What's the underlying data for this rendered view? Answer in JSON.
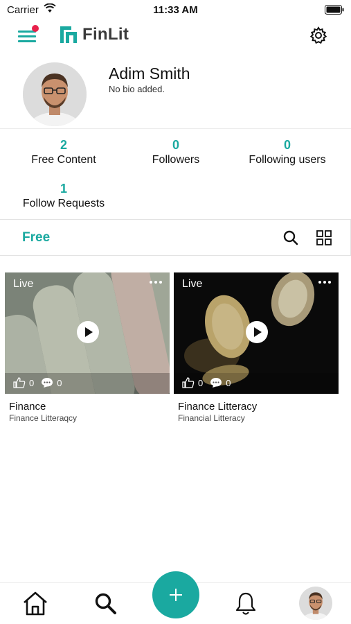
{
  "status_bar": {
    "carrier": "Carrier",
    "time": "11:33 AM"
  },
  "header": {
    "app_name": "FinLit",
    "menu_icon": "hamburger-icon",
    "settings_icon": "gear-icon"
  },
  "profile": {
    "name": "Adim Smith",
    "bio": "No bio added."
  },
  "stats": [
    {
      "value": "2",
      "label": "Free Content"
    },
    {
      "value": "0",
      "label": "Followers"
    },
    {
      "value": "0",
      "label": "Following users"
    },
    {
      "value": "1",
      "label": "Follow Requests"
    }
  ],
  "filter": {
    "active_tab": "Free",
    "search_icon": "search-icon",
    "grid_icon": "grid-icon"
  },
  "content": [
    {
      "badge": "Live",
      "likes": "0",
      "comments": "0",
      "title": "Finance",
      "subtitle": "Finance Litteraqcy"
    },
    {
      "badge": "Live",
      "likes": "0",
      "comments": "0",
      "title": "Finance Litteracy",
      "subtitle": "Financial Litteracy"
    }
  ],
  "tab_bar": {
    "items": [
      "home-icon",
      "search-icon",
      "add-icon",
      "bell-icon",
      "profile-avatar"
    ]
  },
  "colors": {
    "accent": "#1aa9a0",
    "notification_dot": "#e8214b"
  }
}
